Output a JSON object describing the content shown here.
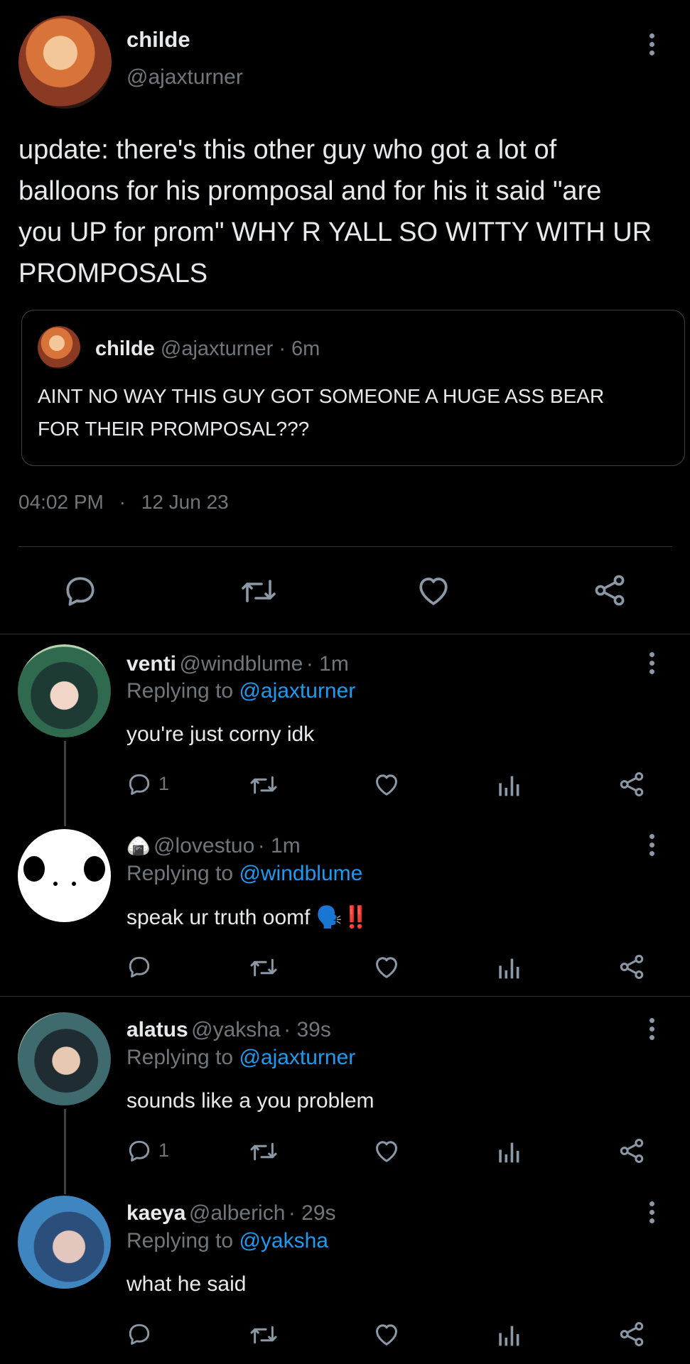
{
  "main_tweet": {
    "display_name": "childe",
    "handle": "@ajaxturner",
    "text_lines": [
      "update: there's this other guy who got a lot of",
      "balloons for his promposal and for his it said \"are",
      "you UP for prom\" WHY R YALL SO WITTY WITH UR",
      "PROMPOSALS"
    ],
    "quote": {
      "display_name": "childe",
      "handle": "@ajaxturner",
      "time": "· 6m",
      "text_lines": [
        "AINT NO WAY THIS GUY GOT SOMEONE A HUGE ASS BEAR",
        "FOR THEIR PROMPOSAL???"
      ]
    },
    "time": "04:02 PM",
    "separator": "·",
    "date": "12 Jun 23"
  },
  "replies": [
    {
      "display_name": "venti",
      "handle": "@windblume",
      "time": "· 1m",
      "replying_prefix": "Replying to",
      "replying_to": "@ajaxturner",
      "text": "you're just corny idk",
      "reply_count": "1"
    },
    {
      "display_name": "🍙",
      "handle": "@lovestuo",
      "time": "· 1m",
      "replying_prefix": "Replying to",
      "replying_to": "@windblume",
      "text": "speak ur truth oomf 🗣️‼️",
      "reply_count": ""
    },
    {
      "display_name": "alatus",
      "handle": "@yaksha",
      "time": "· 39s",
      "replying_prefix": "Replying to",
      "replying_to": "@ajaxturner",
      "text": "sounds like a you problem",
      "reply_count": "1"
    },
    {
      "display_name": "kaeya",
      "handle": "@alberich",
      "time": "· 29s",
      "replying_prefix": "Replying to",
      "replying_to": "@yaksha",
      "text": "what he said",
      "reply_count": ""
    }
  ],
  "colors": {
    "background": "#000000",
    "text": "#e7e9ea",
    "secondary": "#71767b",
    "link": "#1d9bf0",
    "divider": "#2f3336"
  }
}
